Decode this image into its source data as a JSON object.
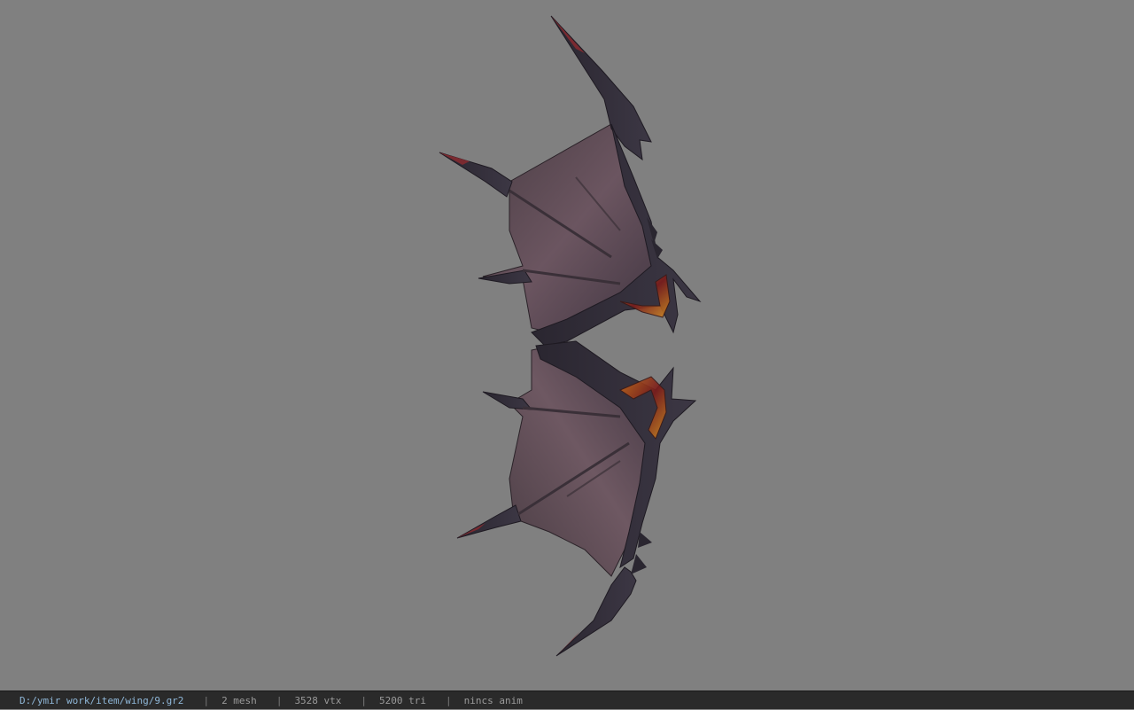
{
  "viewport": {
    "background_color": "#808080",
    "model_name": "bat-wing-model"
  },
  "status_bar": {
    "file_path": "D:/ymir work/item/wing/9.gr2",
    "separator": "|",
    "mesh_count": "2 mesh",
    "vertex_count": "3528 vtx",
    "triangle_count": "5200 tri",
    "anim_status": "nincs anim",
    "path_color": "#8fb7d8",
    "text_color": "#9a9a9a"
  }
}
